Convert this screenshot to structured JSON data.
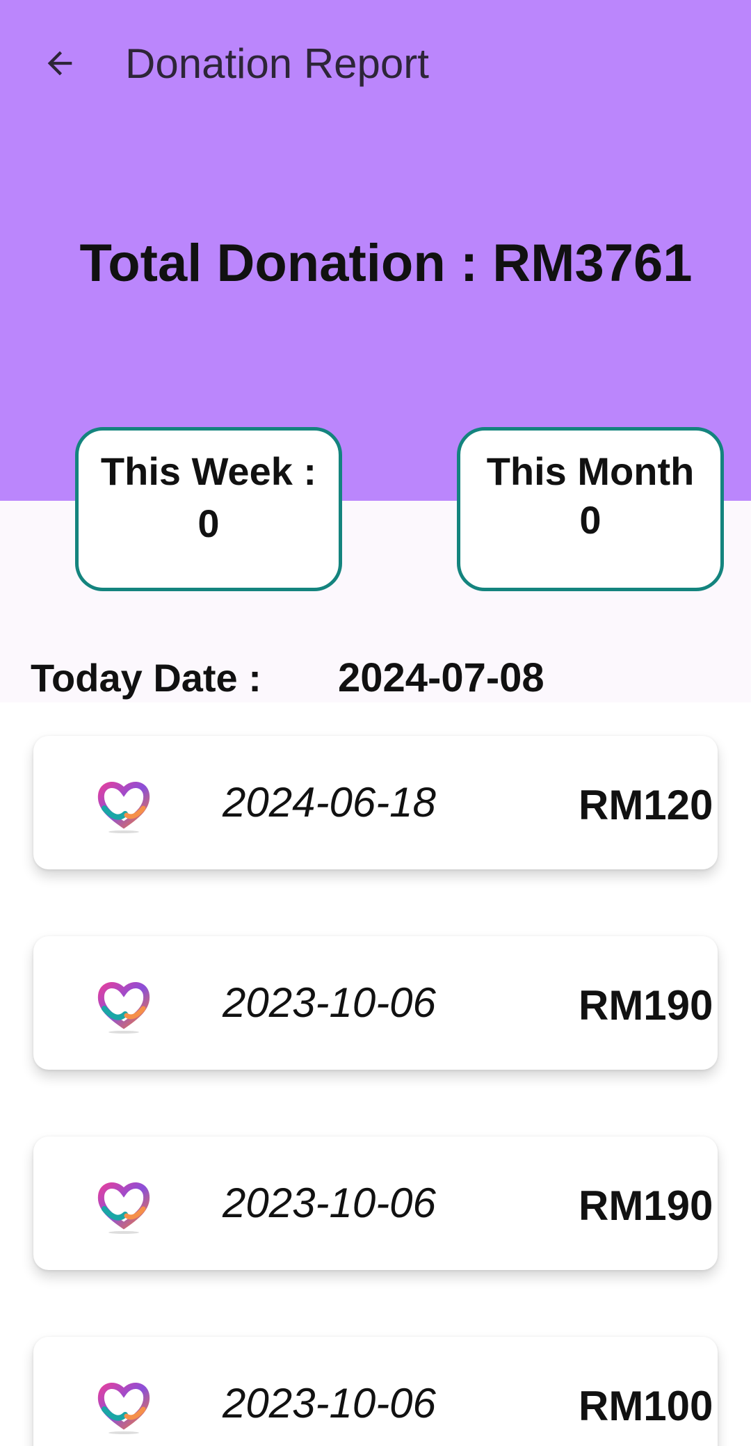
{
  "app_bar": {
    "title": "Donation Report",
    "back_icon": "arrow-back-icon"
  },
  "summary": {
    "total_text": "Total Donation : RM3761",
    "week_label": "This Week :",
    "week_value": "0",
    "month_label": "This Month",
    "month_value": "0",
    "today_label": "Today Date :",
    "today_value": "2024-07-08"
  },
  "donations": [
    {
      "date": "2024-06-18",
      "amount": "RM120",
      "icon": "heart-hands-logo-icon"
    },
    {
      "date": "2023-10-06",
      "amount": "RM190",
      "icon": "heart-hands-logo-icon"
    },
    {
      "date": "2023-10-06",
      "amount": "RM190",
      "icon": "heart-hands-logo-icon"
    },
    {
      "date": "2023-10-06",
      "amount": "RM100",
      "icon": "heart-hands-logo-icon"
    }
  ],
  "colors": {
    "header_bg": "#bb86fc",
    "card_border": "#14847e",
    "page_bg": "#fcf8fd"
  }
}
